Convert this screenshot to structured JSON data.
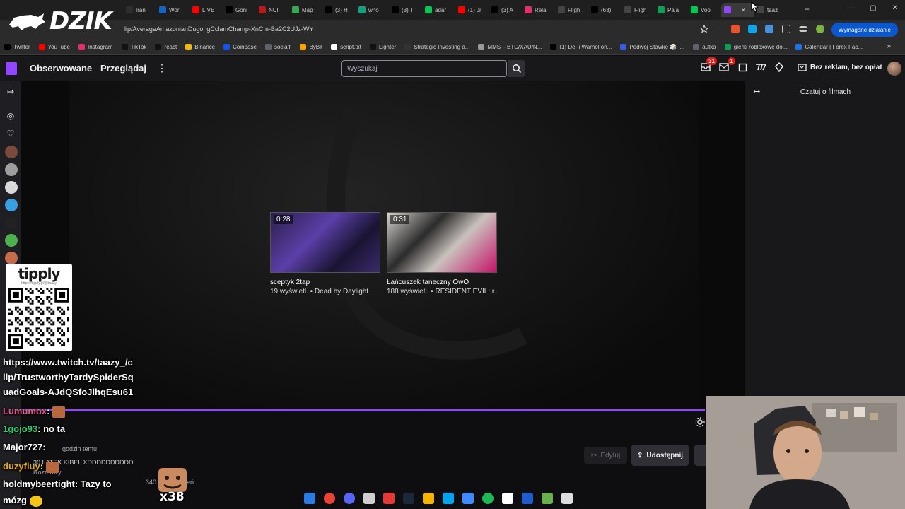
{
  "brand": {
    "name": "DZIK"
  },
  "browser": {
    "tabs": [
      {
        "label": "Iran",
        "color": "#2e2e2e"
      },
      {
        "label": "Worl",
        "color": "#1565c0"
      },
      {
        "label": "LIVE",
        "color": "#ff0000"
      },
      {
        "label": "Goni",
        "color": "#000000"
      },
      {
        "label": "NUI",
        "color": "#b71c1c"
      },
      {
        "label": "Map",
        "color": "#34a853"
      },
      {
        "label": "(3) H",
        "color": "#000000"
      },
      {
        "label": "who",
        "color": "#10a37f"
      },
      {
        "label": "(3) T",
        "color": "#000000"
      },
      {
        "label": "adar",
        "color": "#00c853"
      },
      {
        "label": "(1) Jr",
        "color": "#ff0000"
      },
      {
        "label": "(3) A",
        "color": "#000000"
      },
      {
        "label": "Rela",
        "color": "#e1306c"
      },
      {
        "label": "Fligh",
        "color": "#444444"
      },
      {
        "label": "(63)",
        "color": "#000000"
      },
      {
        "label": "Fligh",
        "color": "#444444"
      },
      {
        "label": "Paja",
        "color": "#0f9d58"
      },
      {
        "label": "Vool",
        "color": "#00c853"
      },
      {
        "label": "",
        "color": "#9147ff",
        "active": true
      },
      {
        "label": "taaz",
        "color": "#444444"
      }
    ],
    "new_tab_label": "+",
    "url": "lip/AverageAmazonianDugongCclamChamp-XnCm-Ba2C2UJz-WY",
    "action_required_label": "Wymagane działanie",
    "bookmarks": [
      {
        "label": "Twitter",
        "color": "#000000"
      },
      {
        "label": "YouTube",
        "color": "#ff0000"
      },
      {
        "label": "Instagram",
        "color": "#e1306c"
      },
      {
        "label": "TikTok",
        "color": "#111111"
      },
      {
        "label": "react",
        "color": "#111111"
      },
      {
        "label": "Binance",
        "color": "#f0b90b"
      },
      {
        "label": "Coinbase",
        "color": "#1652f0"
      },
      {
        "label": "socialfi",
        "color": "#5f6368"
      },
      {
        "label": "ByBit",
        "color": "#f7a600"
      },
      {
        "label": "script.txt",
        "color": "#ffffff"
      },
      {
        "label": "Lighter",
        "color": "#111111"
      },
      {
        "label": "Strategic Investing a...",
        "color": "#333333"
      },
      {
        "label": "MMS – BTC/XAU/N...",
        "color": "#999999"
      },
      {
        "label": "(1) DeFi Warhol on...",
        "color": "#000000"
      },
      {
        "label": "Podwój Stawkę 🎲 |...",
        "color": "#3b5bdb"
      },
      {
        "label": "autka",
        "color": "#5f6368"
      },
      {
        "label": "gierki robloxowe do...",
        "color": "#0f9d58"
      },
      {
        "label": "Calendar | Forex Fac...",
        "color": "#1a73e8"
      }
    ]
  },
  "twitch": {
    "nav": {
      "following": "Obserwowane",
      "browse": "Przeglądaj"
    },
    "search_placeholder": "Wyszukaj",
    "inbox_badge": "31",
    "notifications_badge": "1",
    "no_ads_label": "Bez reklam, bez opłat",
    "chat_panel_title": "Czatuj o filmach",
    "clips": [
      {
        "duration": "0:28",
        "title": "sceptyk 2tap",
        "meta": "19 wyświetl. • Dead by Daylight"
      },
      {
        "duration": "0:31",
        "title": "Łańcuszek taneczny OwO",
        "meta": "188 wyświetl. • RESIDENT EVIL: r..."
      }
    ],
    "edit_label": "Edytuj",
    "share_label": "Udostępnij"
  },
  "overlay": {
    "tipply_logo": "tipply",
    "tipply_url": "https://tipply.pl/@taazy",
    "chat_lines": [
      {
        "text": "https://www.twitch.tv/taazy_/c"
      },
      {
        "text": "lip/TrustworthyTardySpiderSq"
      },
      {
        "text": "uadGoals-AJdQSfoJihqEsu61"
      },
      {
        "nick": "Lumumox",
        "nick_color": "#e05a8c",
        "text": ":"
      },
      {
        "nick": "1gojo93",
        "nick_color": "#2ecc71",
        "text": ": no ta"
      },
      {
        "nick": "Major727",
        "nick_color": "#ffffff",
        "text": ":"
      },
      {
        "nick": "duzyfiuy",
        "nick_color": "#e6a817",
        "text": ":"
      },
      {
        "nick": "holdmybeertight",
        "nick_color": "#ffffff",
        "text": ": Tazy to"
      },
      {
        "nick": "",
        "nick_color": "#ffffff",
        "text": "mózg"
      }
    ],
    "emote_count": "x38",
    "underlay": [
      {
        "text": "godzin temu"
      },
      {
        "text": "30 LATEK      KIBEL XDDDDDDDDDD"
      },
      {
        "text": "Rozmowy"
      },
      {
        "text": ". 340"
      },
      {
        "text": "ień"
      }
    ]
  }
}
